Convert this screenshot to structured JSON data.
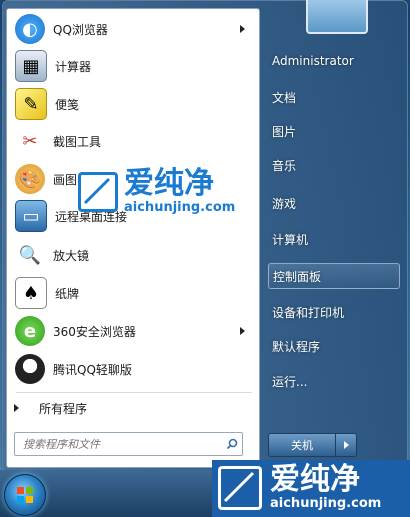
{
  "programs": [
    {
      "label": "QQ浏览器",
      "icon": "qq-browser-icon",
      "has_submenu": true
    },
    {
      "label": "计算器",
      "icon": "calculator-icon",
      "has_submenu": false
    },
    {
      "label": "便笺",
      "icon": "sticky-notes-icon",
      "has_submenu": false
    },
    {
      "label": "截图工具",
      "icon": "snipping-tool-icon",
      "has_submenu": false
    },
    {
      "label": "画图",
      "icon": "paint-icon",
      "has_submenu": false
    },
    {
      "label": "远程桌面连接",
      "icon": "remote-desktop-icon",
      "has_submenu": false
    },
    {
      "label": "放大镜",
      "icon": "magnifier-icon",
      "has_submenu": false
    },
    {
      "label": "纸牌",
      "icon": "solitaire-icon",
      "has_submenu": false
    },
    {
      "label": "360安全浏览器",
      "icon": "360-browser-icon",
      "has_submenu": true
    },
    {
      "label": "腾讯QQ轻聊版",
      "icon": "qq-penguin-icon",
      "has_submenu": false
    }
  ],
  "all_programs": "所有程序",
  "search": {
    "placeholder": "搜索程序和文件"
  },
  "right_menu": [
    {
      "label": "Administrator"
    },
    {
      "label": "文档"
    },
    {
      "label": "图片"
    },
    {
      "label": "音乐"
    },
    {
      "label": "游戏"
    },
    {
      "label": "计算机"
    },
    {
      "label": "控制面板",
      "selected": true
    },
    {
      "label": "设备和打印机"
    },
    {
      "label": "默认程序"
    },
    {
      "label": "运行..."
    }
  ],
  "shutdown": {
    "label": "关机"
  },
  "watermark": {
    "title": "爱纯净",
    "domain": "aichunjing.com"
  },
  "colors": {
    "accent": "#2f5f8f",
    "watermark_blue": "#1a7bd0"
  }
}
